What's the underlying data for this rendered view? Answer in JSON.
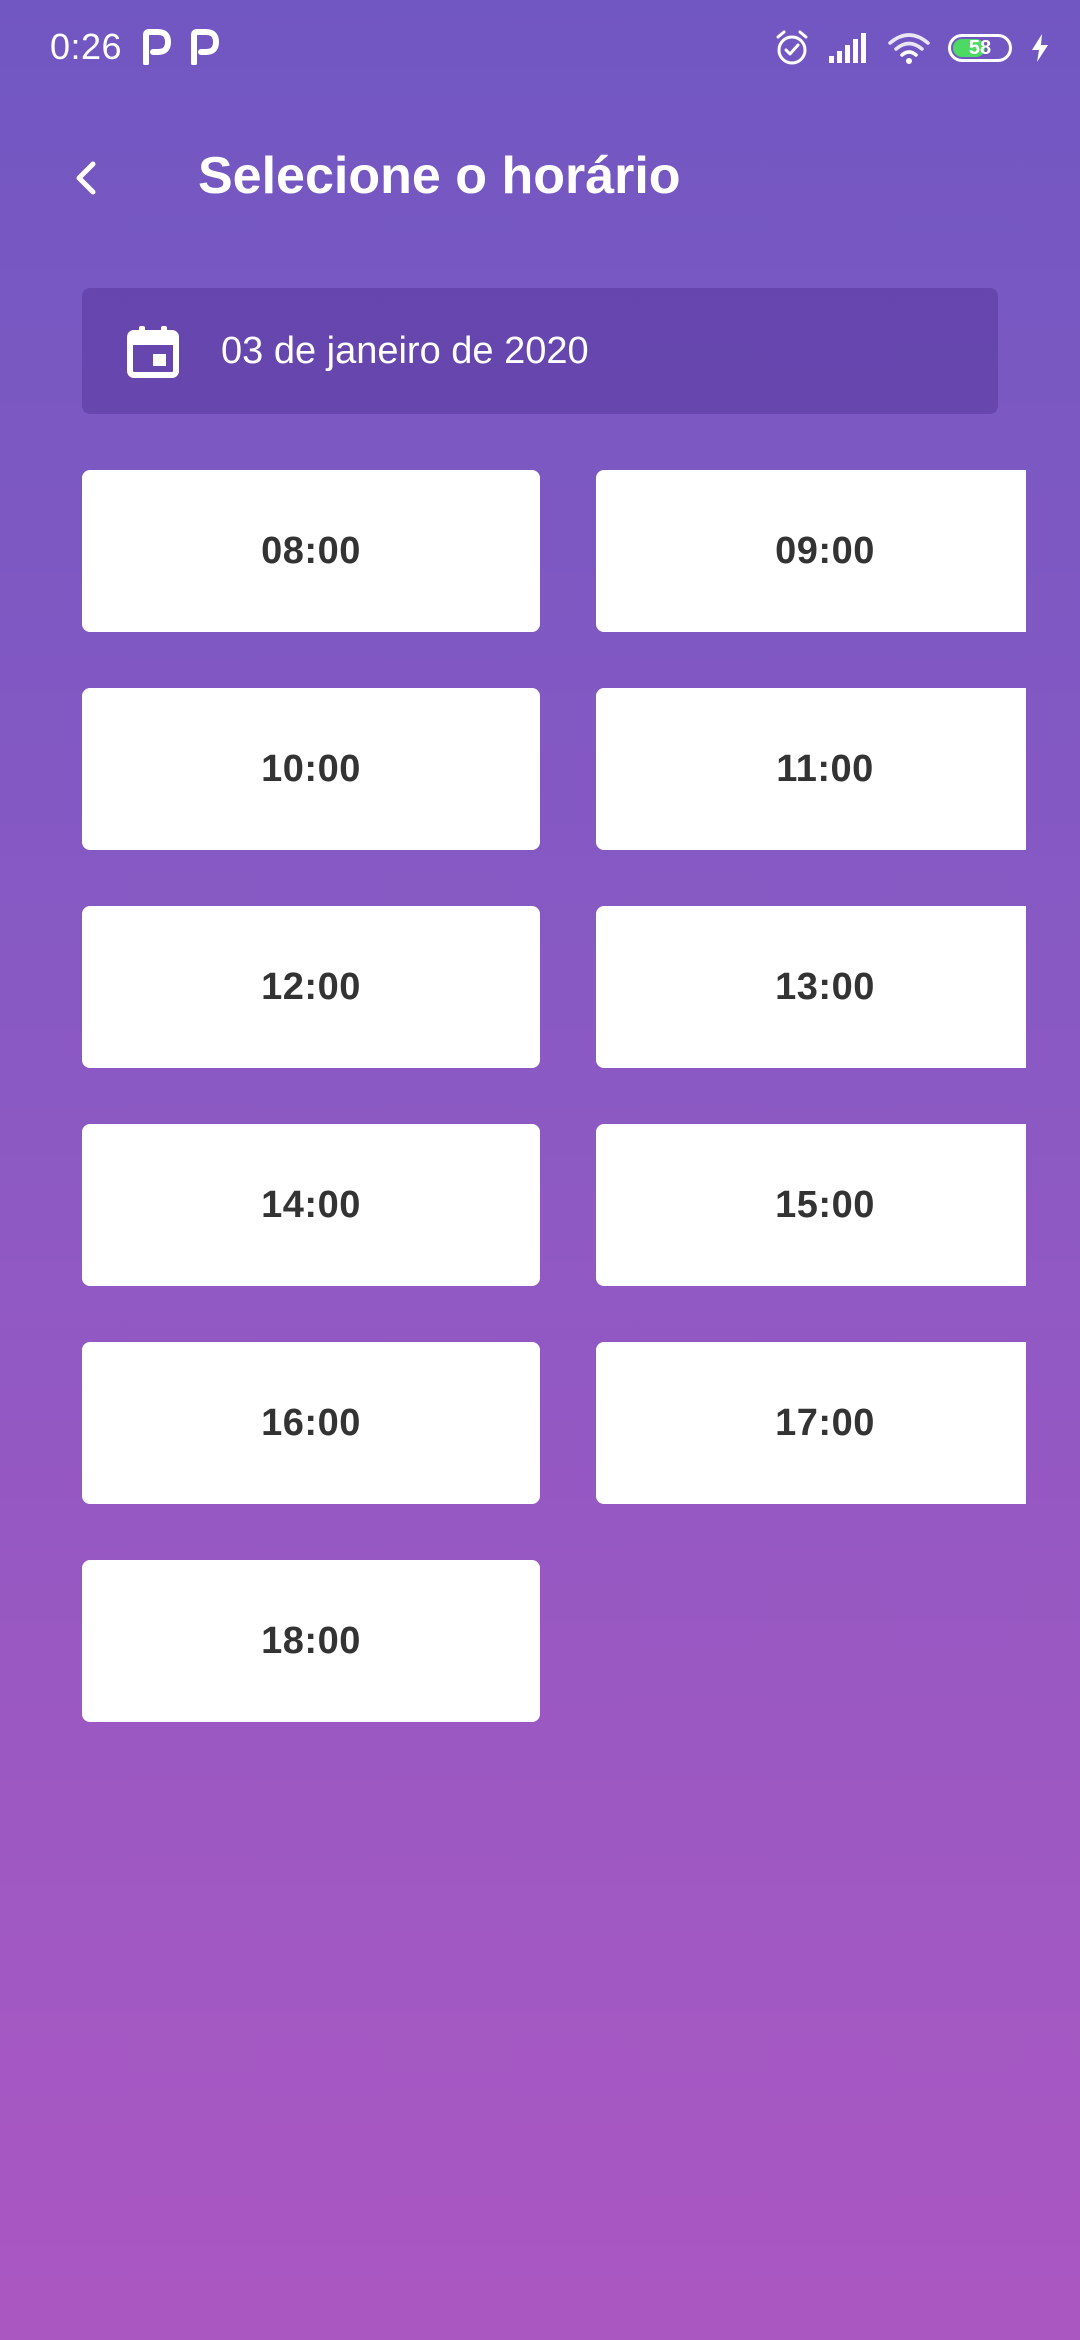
{
  "status_bar": {
    "time": "0:26",
    "battery_level": "58",
    "icons": [
      "p-app-icon",
      "p-app-icon",
      "alarm-icon",
      "signal-icon",
      "wifi-icon",
      "battery-icon",
      "charging-icon"
    ]
  },
  "header": {
    "title": "Selecione o horário",
    "back_icon": "chevron-left-icon"
  },
  "date_field": {
    "value": "03 de janeiro de 2020",
    "icon": "calendar-icon"
  },
  "slots": [
    {
      "label": "08:00"
    },
    {
      "label": "09:00"
    },
    {
      "label": "10:00"
    },
    {
      "label": "11:00"
    },
    {
      "label": "12:00"
    },
    {
      "label": "13:00"
    },
    {
      "label": "14:00"
    },
    {
      "label": "15:00"
    },
    {
      "label": "16:00"
    },
    {
      "label": "17:00"
    },
    {
      "label": "18:00"
    }
  ],
  "colors": {
    "background_top": "#7157c2",
    "background_bottom": "#ab57c2",
    "slot_background": "#ffffff",
    "slot_text": "#333333",
    "battery_fill": "#4cd964"
  }
}
